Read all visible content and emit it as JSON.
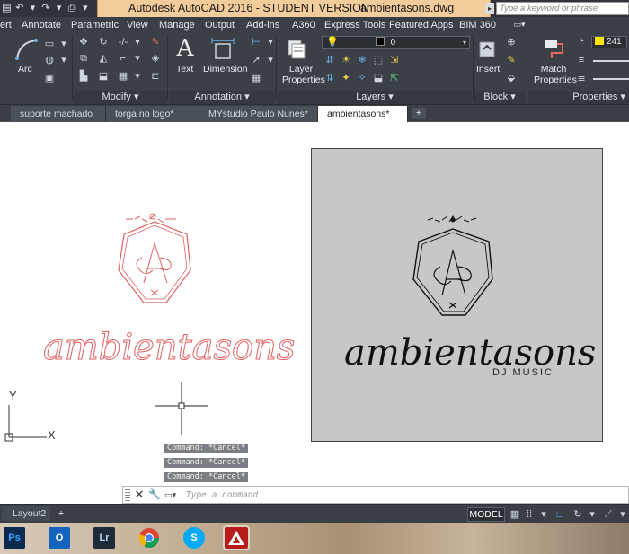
{
  "app": {
    "title": "Autodesk AutoCAD 2016 - STUDENT VERSION",
    "file_name": "ambientasons.dwg",
    "search_placeholder": "Type a keyword or phrase"
  },
  "ribbon_tabs": [
    "ert",
    "Annotate",
    "Parametric",
    "View",
    "Manage",
    "Output",
    "Add-ins",
    "A360",
    "Express Tools",
    "Featured Apps",
    "BIM 360"
  ],
  "ribbon": {
    "arc_label": "Arc",
    "modify_label": "Modify",
    "text_label": "Text",
    "dimension_label": "Dimension",
    "annotation_label": "Annotation",
    "layer_properties_label": "Layer Properties",
    "layer_current": "0",
    "layers_label": "Layers",
    "insert_label": "Insert",
    "block_label": "Block",
    "match_properties_label": "Match Properties",
    "properties_label": "Properties",
    "color_value": "241"
  },
  "file_tabs": [
    {
      "label": "suporte machado",
      "active": false
    },
    {
      "label": "torga no logo*",
      "active": false
    },
    {
      "label": "MYstudio Paulo Nunes*",
      "active": false
    },
    {
      "label": "ambientasons*",
      "active": true
    }
  ],
  "canvas": {
    "left_logo_word": "ambientasons",
    "right_logo_word": "ambientasons",
    "right_logo_sub": "DJ MUSIC",
    "ucs_y": "Y",
    "ucs_x": "X"
  },
  "command_history": [
    "Command: *Cancel*",
    "Command: *Cancel*",
    "Command: *Cancel*"
  ],
  "command_line": {
    "placeholder": "Type a command"
  },
  "status": {
    "layout_tab": "Layout2",
    "model_button": "MODEL"
  },
  "taskbar": {
    "apps": [
      {
        "name": "Ps",
        "color": "#0c2a4d"
      },
      {
        "name": "O",
        "color": "#1565c0"
      },
      {
        "name": "Lr",
        "color": "#1e2a38"
      },
      {
        "name": "",
        "color": "#ffffff"
      },
      {
        "name": "S",
        "color": "#03a9f4"
      },
      {
        "name": "A",
        "color": "#c62828"
      }
    ]
  },
  "colors": {
    "title_tab": "#f2cc9a",
    "ribbon_bg": "#3b4047",
    "left_logo": "#e06060",
    "right_logo_bg": "#c7c7c7"
  }
}
